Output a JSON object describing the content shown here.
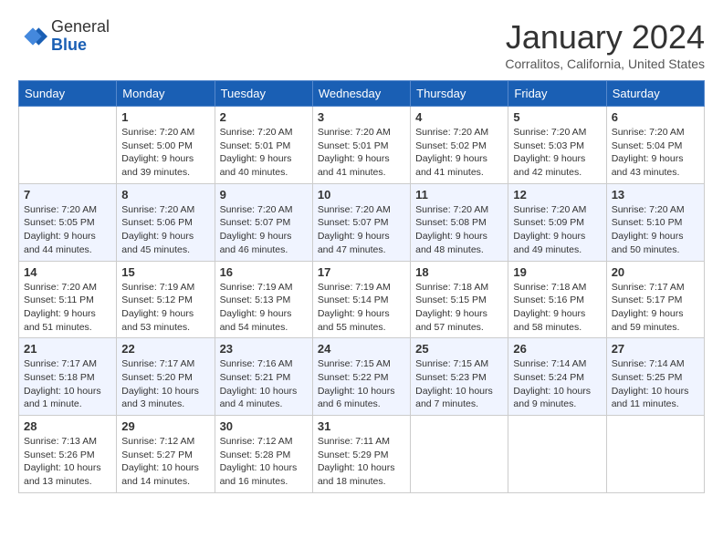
{
  "header": {
    "logo_line1": "General",
    "logo_line2": "Blue",
    "month": "January 2024",
    "location": "Corralitos, California, United States"
  },
  "days_of_week": [
    "Sunday",
    "Monday",
    "Tuesday",
    "Wednesday",
    "Thursday",
    "Friday",
    "Saturday"
  ],
  "weeks": [
    [
      {
        "day": "",
        "info": ""
      },
      {
        "day": "1",
        "info": "Sunrise: 7:20 AM\nSunset: 5:00 PM\nDaylight: 9 hours\nand 39 minutes."
      },
      {
        "day": "2",
        "info": "Sunrise: 7:20 AM\nSunset: 5:01 PM\nDaylight: 9 hours\nand 40 minutes."
      },
      {
        "day": "3",
        "info": "Sunrise: 7:20 AM\nSunset: 5:01 PM\nDaylight: 9 hours\nand 41 minutes."
      },
      {
        "day": "4",
        "info": "Sunrise: 7:20 AM\nSunset: 5:02 PM\nDaylight: 9 hours\nand 41 minutes."
      },
      {
        "day": "5",
        "info": "Sunrise: 7:20 AM\nSunset: 5:03 PM\nDaylight: 9 hours\nand 42 minutes."
      },
      {
        "day": "6",
        "info": "Sunrise: 7:20 AM\nSunset: 5:04 PM\nDaylight: 9 hours\nand 43 minutes."
      }
    ],
    [
      {
        "day": "7",
        "info": "Sunrise: 7:20 AM\nSunset: 5:05 PM\nDaylight: 9 hours\nand 44 minutes."
      },
      {
        "day": "8",
        "info": "Sunrise: 7:20 AM\nSunset: 5:06 PM\nDaylight: 9 hours\nand 45 minutes."
      },
      {
        "day": "9",
        "info": "Sunrise: 7:20 AM\nSunset: 5:07 PM\nDaylight: 9 hours\nand 46 minutes."
      },
      {
        "day": "10",
        "info": "Sunrise: 7:20 AM\nSunset: 5:07 PM\nDaylight: 9 hours\nand 47 minutes."
      },
      {
        "day": "11",
        "info": "Sunrise: 7:20 AM\nSunset: 5:08 PM\nDaylight: 9 hours\nand 48 minutes."
      },
      {
        "day": "12",
        "info": "Sunrise: 7:20 AM\nSunset: 5:09 PM\nDaylight: 9 hours\nand 49 minutes."
      },
      {
        "day": "13",
        "info": "Sunrise: 7:20 AM\nSunset: 5:10 PM\nDaylight: 9 hours\nand 50 minutes."
      }
    ],
    [
      {
        "day": "14",
        "info": "Sunrise: 7:20 AM\nSunset: 5:11 PM\nDaylight: 9 hours\nand 51 minutes."
      },
      {
        "day": "15",
        "info": "Sunrise: 7:19 AM\nSunset: 5:12 PM\nDaylight: 9 hours\nand 53 minutes."
      },
      {
        "day": "16",
        "info": "Sunrise: 7:19 AM\nSunset: 5:13 PM\nDaylight: 9 hours\nand 54 minutes."
      },
      {
        "day": "17",
        "info": "Sunrise: 7:19 AM\nSunset: 5:14 PM\nDaylight: 9 hours\nand 55 minutes."
      },
      {
        "day": "18",
        "info": "Sunrise: 7:18 AM\nSunset: 5:15 PM\nDaylight: 9 hours\nand 57 minutes."
      },
      {
        "day": "19",
        "info": "Sunrise: 7:18 AM\nSunset: 5:16 PM\nDaylight: 9 hours\nand 58 minutes."
      },
      {
        "day": "20",
        "info": "Sunrise: 7:17 AM\nSunset: 5:17 PM\nDaylight: 9 hours\nand 59 minutes."
      }
    ],
    [
      {
        "day": "21",
        "info": "Sunrise: 7:17 AM\nSunset: 5:18 PM\nDaylight: 10 hours\nand 1 minute."
      },
      {
        "day": "22",
        "info": "Sunrise: 7:17 AM\nSunset: 5:20 PM\nDaylight: 10 hours\nand 3 minutes."
      },
      {
        "day": "23",
        "info": "Sunrise: 7:16 AM\nSunset: 5:21 PM\nDaylight: 10 hours\nand 4 minutes."
      },
      {
        "day": "24",
        "info": "Sunrise: 7:15 AM\nSunset: 5:22 PM\nDaylight: 10 hours\nand 6 minutes."
      },
      {
        "day": "25",
        "info": "Sunrise: 7:15 AM\nSunset: 5:23 PM\nDaylight: 10 hours\nand 7 minutes."
      },
      {
        "day": "26",
        "info": "Sunrise: 7:14 AM\nSunset: 5:24 PM\nDaylight: 10 hours\nand 9 minutes."
      },
      {
        "day": "27",
        "info": "Sunrise: 7:14 AM\nSunset: 5:25 PM\nDaylight: 10 hours\nand 11 minutes."
      }
    ],
    [
      {
        "day": "28",
        "info": "Sunrise: 7:13 AM\nSunset: 5:26 PM\nDaylight: 10 hours\nand 13 minutes."
      },
      {
        "day": "29",
        "info": "Sunrise: 7:12 AM\nSunset: 5:27 PM\nDaylight: 10 hours\nand 14 minutes."
      },
      {
        "day": "30",
        "info": "Sunrise: 7:12 AM\nSunset: 5:28 PM\nDaylight: 10 hours\nand 16 minutes."
      },
      {
        "day": "31",
        "info": "Sunrise: 7:11 AM\nSunset: 5:29 PM\nDaylight: 10 hours\nand 18 minutes."
      },
      {
        "day": "",
        "info": ""
      },
      {
        "day": "",
        "info": ""
      },
      {
        "day": "",
        "info": ""
      }
    ]
  ]
}
